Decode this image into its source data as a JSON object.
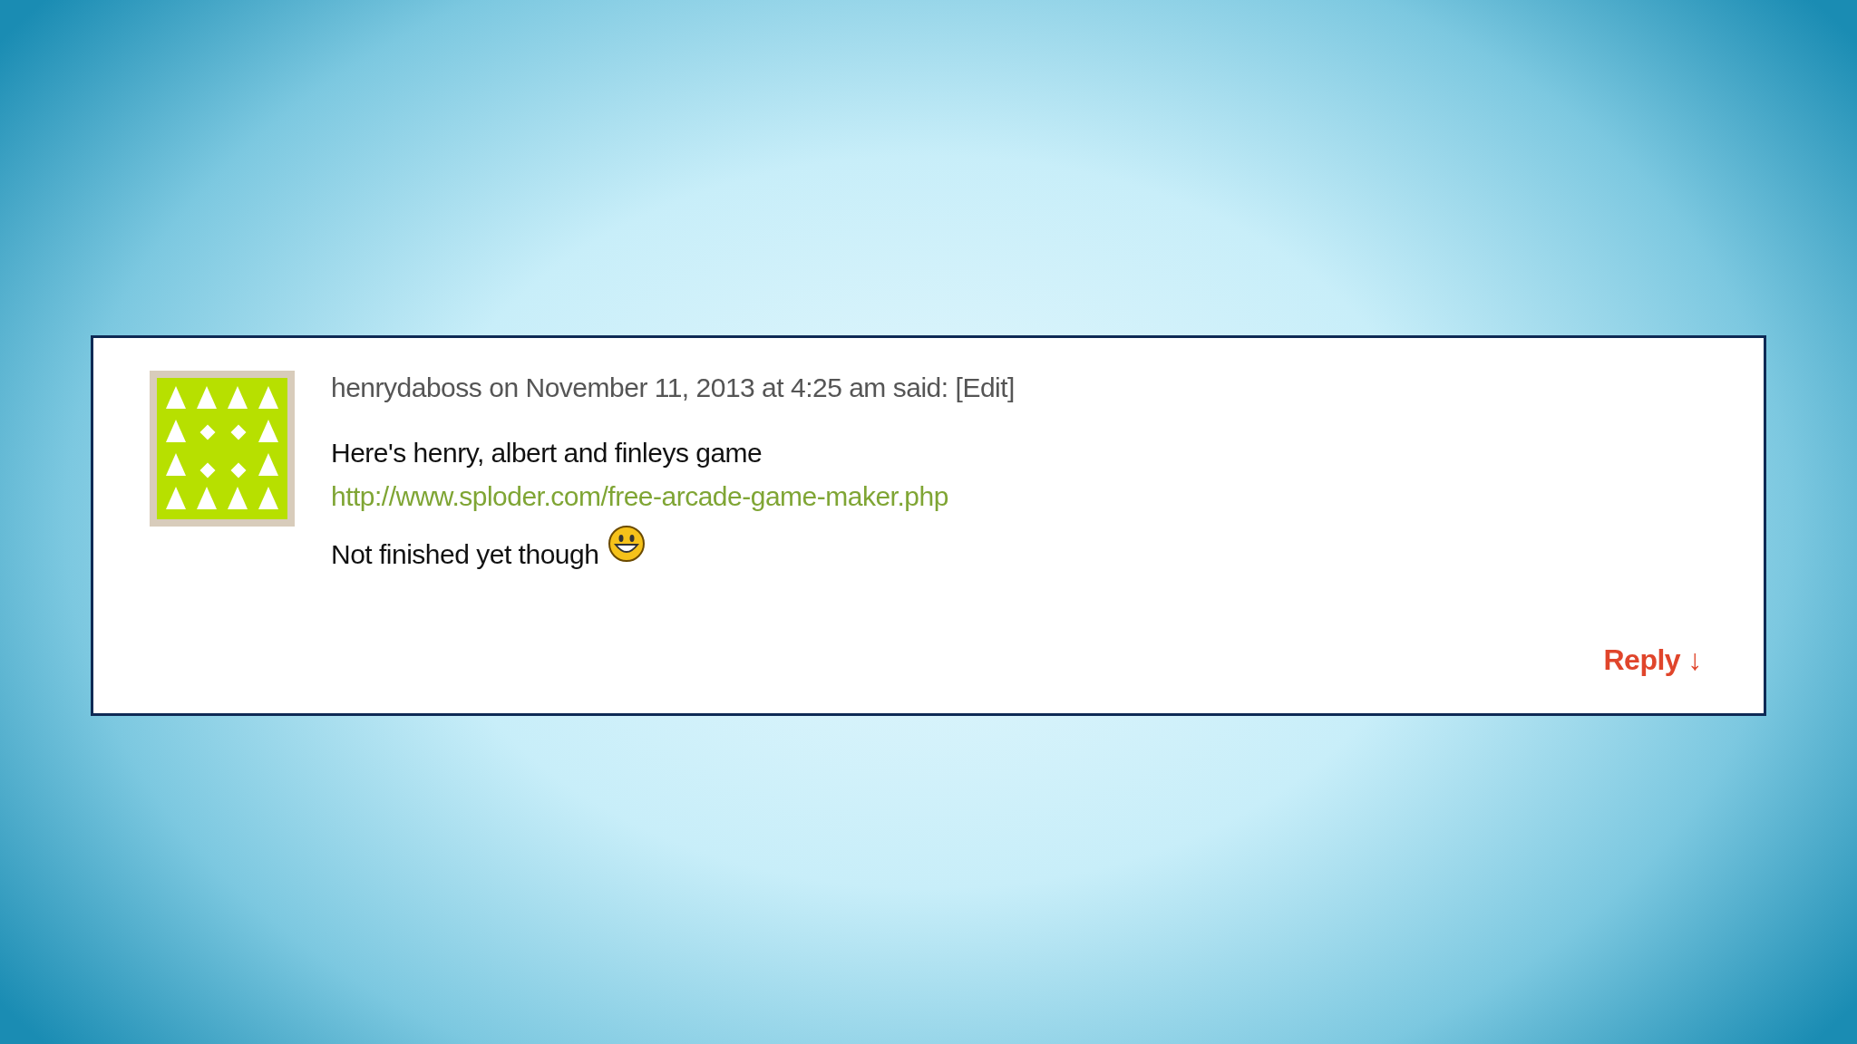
{
  "comment": {
    "author": "henrydaboss",
    "meta": "on November 11, 2013 at 4:25 am said:",
    "edit_link": "[Edit]",
    "lines": [
      {
        "kind": "text",
        "text": "Here's henry, albert and finleys game"
      },
      {
        "kind": "link",
        "text": "http://www.sploder.com/free-arcade-game-maker.php"
      },
      {
        "kind": "text_emoji",
        "text": "Not finished yet though"
      }
    ],
    "reply": "Reply ↓"
  }
}
